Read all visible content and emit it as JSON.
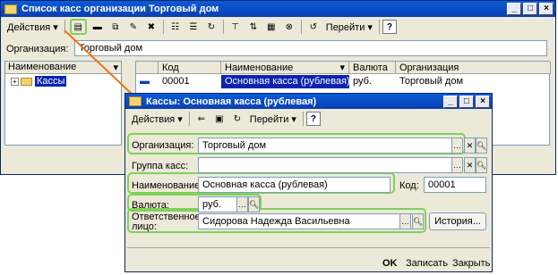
{
  "main_window": {
    "title": "Список касс организации Торговый дом",
    "toolbar": {
      "actions_label": "Действия",
      "goto_label": "Перейти",
      "help_label": "?"
    },
    "org_label": "Организация:",
    "org_value": "Торговый дом",
    "tree": {
      "header": "Наименование",
      "item": "Кассы"
    },
    "table": {
      "columns": [
        "Код",
        "Наименование",
        "Валюта",
        "Организация"
      ],
      "rows": [
        {
          "code": "00001",
          "name": "Основная касса (рублевая)",
          "currency": "руб.",
          "org": "Торговый дом"
        }
      ]
    }
  },
  "dialog": {
    "title": "Кассы: Основная касса (рублевая)",
    "toolbar": {
      "actions_label": "Действия",
      "goto_label": "Перейти",
      "help_label": "?"
    },
    "org_label": "Организация:",
    "org_value": "Торговый дом",
    "group_label": "Группа касс:",
    "group_value": "",
    "name_label": "Наименование:",
    "name_value": "Основная касса (рублевая)",
    "code_label": "Код:",
    "code_value": "00001",
    "currency_label": "Валюта:",
    "currency_value": "руб.",
    "resp_label_1": "Ответственное",
    "resp_label_2": "лицо:",
    "resp_value": "Сидорова Надежда Васильевна",
    "history_label": "История...",
    "ok_label": "OK",
    "save_label": "Записать",
    "close_label": "Закрыть"
  },
  "colors": {
    "highlight": "#7ed25a",
    "arrow": "#e8731c",
    "title_blue": "#0a4fc8",
    "selection": "#0a24b0"
  }
}
